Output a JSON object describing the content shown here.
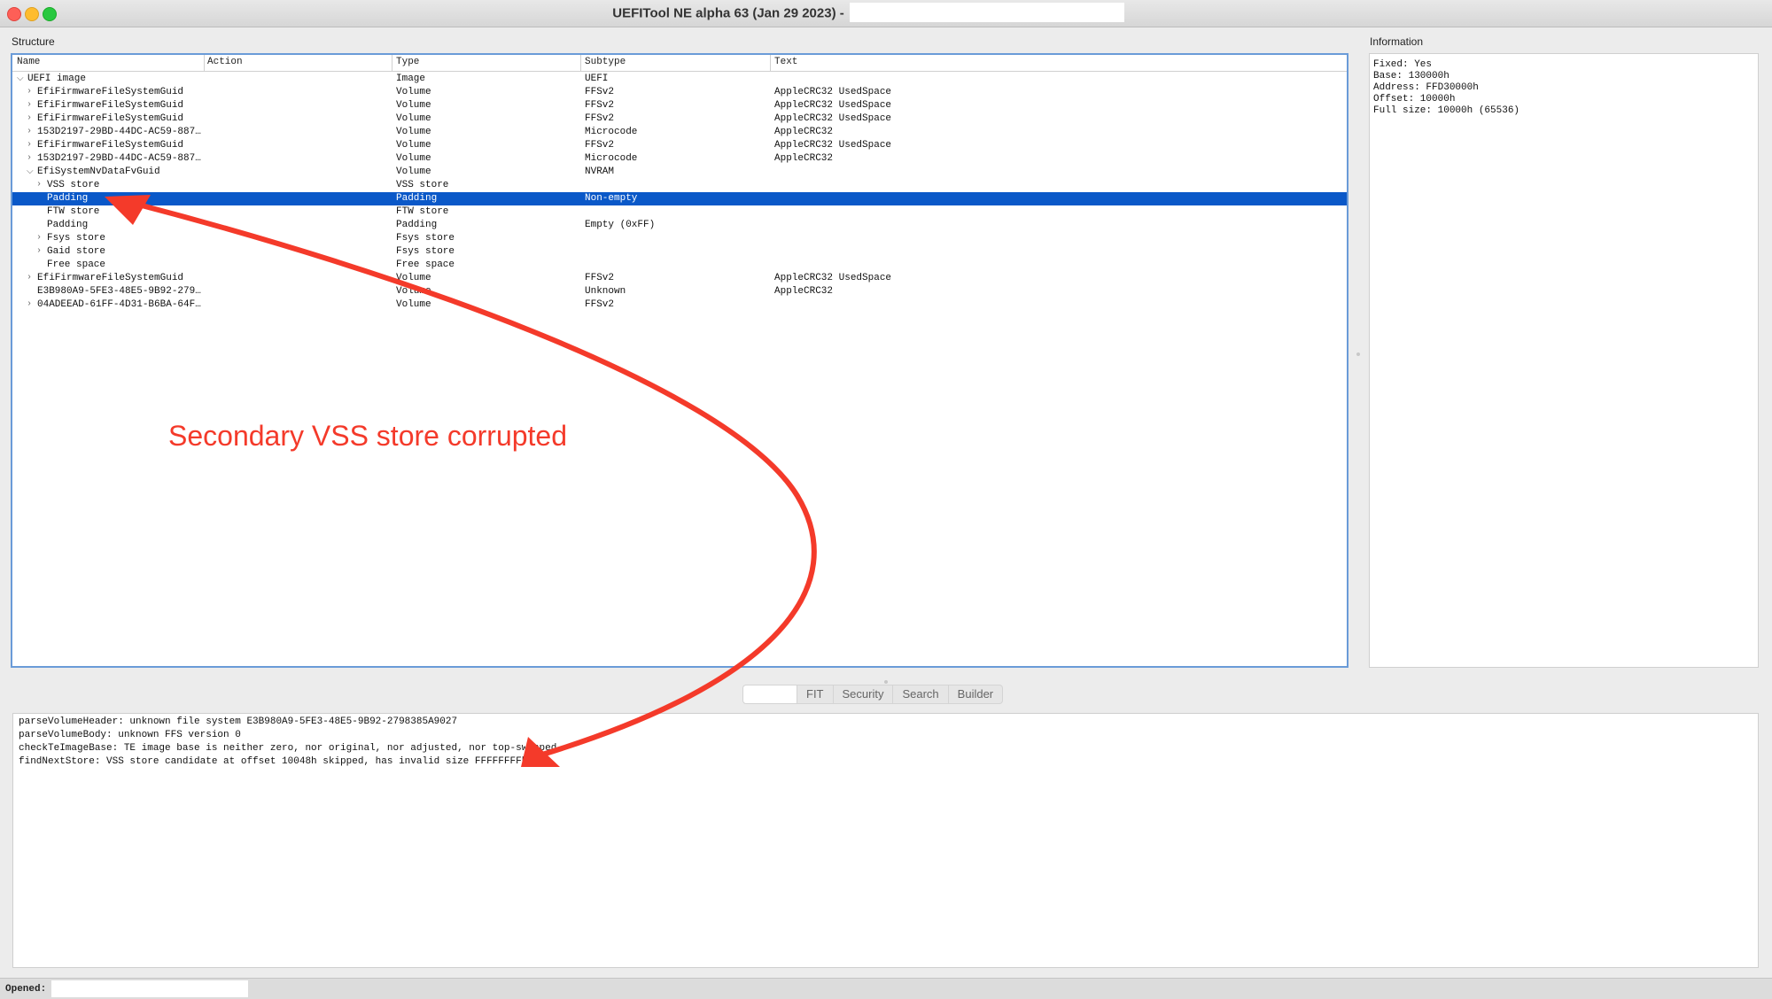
{
  "window": {
    "title": "UEFITool NE alpha 63 (Jan 29 2023) -"
  },
  "structure": {
    "label": "Structure",
    "columns": [
      "Name",
      "Action",
      "Type",
      "Subtype",
      "Text"
    ],
    "rows": [
      {
        "name": "UEFI image",
        "type": "Image",
        "subtype": "UEFI",
        "text": "",
        "chevron": "⌵"
      },
      {
        "name": "EfiFirmwareFileSystemGuid",
        "type": "Volume",
        "subtype": "FFSv2",
        "text": "AppleCRC32 UsedSpace",
        "chevron": "›"
      },
      {
        "name": "EfiFirmwareFileSystemGuid",
        "type": "Volume",
        "subtype": "FFSv2",
        "text": "AppleCRC32 UsedSpace",
        "chevron": "›"
      },
      {
        "name": "EfiFirmwareFileSystemGuid",
        "type": "Volume",
        "subtype": "FFSv2",
        "text": "AppleCRC32 UsedSpace",
        "chevron": "›"
      },
      {
        "name": "153D2197-29BD-44DC-AC59-887…",
        "type": "Volume",
        "subtype": "Microcode",
        "text": "AppleCRC32",
        "chevron": "›"
      },
      {
        "name": "EfiFirmwareFileSystemGuid",
        "type": "Volume",
        "subtype": "FFSv2",
        "text": "AppleCRC32 UsedSpace",
        "chevron": "›"
      },
      {
        "name": "153D2197-29BD-44DC-AC59-887…",
        "type": "Volume",
        "subtype": "Microcode",
        "text": "AppleCRC32",
        "chevron": "›"
      },
      {
        "name": "EfiSystemNvDataFvGuid",
        "type": "Volume",
        "subtype": "NVRAM",
        "text": "",
        "chevron": "⌵"
      },
      {
        "name": "VSS store",
        "type": "VSS store",
        "subtype": "",
        "text": "",
        "chevron": "›"
      },
      {
        "name": "Padding",
        "type": "Padding",
        "subtype": "Non-empty",
        "text": "",
        "chevron": ""
      },
      {
        "name": "FTW store",
        "type": "FTW store",
        "subtype": "",
        "text": "",
        "chevron": ""
      },
      {
        "name": "Padding",
        "type": "Padding",
        "subtype": "Empty (0xFF)",
        "text": "",
        "chevron": ""
      },
      {
        "name": "Fsys store",
        "type": "Fsys store",
        "subtype": "",
        "text": "",
        "chevron": "›"
      },
      {
        "name": "Gaid store",
        "type": "Fsys store",
        "subtype": "",
        "text": "",
        "chevron": "›"
      },
      {
        "name": "Free space",
        "type": "Free space",
        "subtype": "",
        "text": "",
        "chevron": ""
      },
      {
        "name": "EfiFirmwareFileSystemGuid",
        "type": "Volume",
        "subtype": "FFSv2",
        "text": "AppleCRC32 UsedSpace",
        "chevron": "›"
      },
      {
        "name": "E3B980A9-5FE3-48E5-9B92-279…",
        "type": "Volume",
        "subtype": "Unknown",
        "text": "AppleCRC32",
        "chevron": ""
      },
      {
        "name": "04ADEEAD-61FF-4D31-B6BA-64F…",
        "type": "Volume",
        "subtype": "FFSv2",
        "text": "",
        "chevron": "›"
      }
    ]
  },
  "information": {
    "label": "Information",
    "lines": [
      "Fixed: Yes",
      "Base: 130000h",
      "Address: FFD30000h",
      "Offset: 10000h",
      "Full size: 10000h (65536)"
    ]
  },
  "tabs": [
    "",
    "FIT",
    "Security",
    "Search",
    "Builder"
  ],
  "log": [
    "parseVolumeHeader: unknown file system E3B980A9-5FE3-48E5-9B92-2798385A9027",
    "parseVolumeBody: unknown FFS version 0",
    "checkTeImageBase: TE image base is neither zero, nor original, nor adjusted, nor top-swapped",
    "findNextStore: VSS store candidate at offset 10048h skipped, has invalid size FFFFFFFFh"
  ],
  "status": {
    "label": "Opened:"
  },
  "annotation": {
    "text": "Secondary VSS store corrupted",
    "color": "#f43a2a"
  }
}
